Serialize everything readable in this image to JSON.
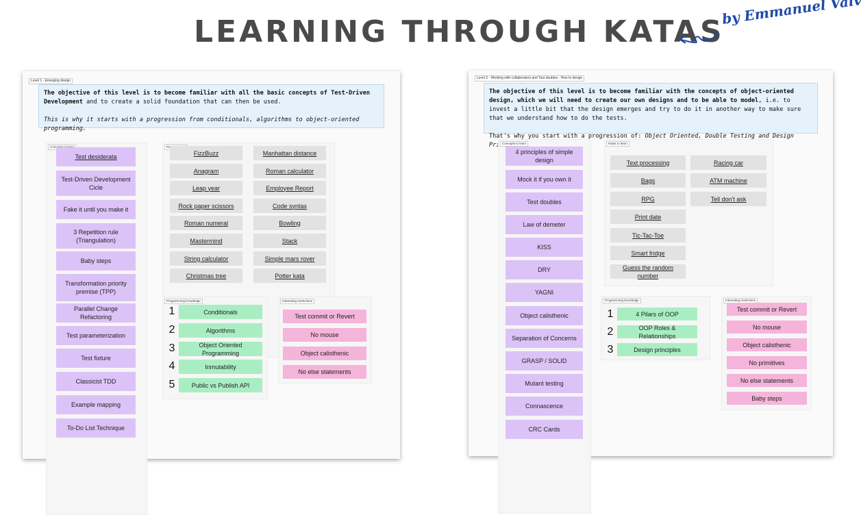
{
  "header": {
    "title": "LEARNING THROUGH KATAS",
    "author": "by Emmanuel Valverde"
  },
  "level1": {
    "tag": "Level 1 - Emerging design",
    "description": {
      "p1_bold": "The objective of this level is to become familiar with all the basic concepts of Test-Driven Development",
      "p1_rest": " and to create a solid foundation that can then be used.",
      "p2": "This is why it starts with a progression from conditionals, algorithms to object-oriented programming."
    },
    "concepts": {
      "tag": "Concepts to learn",
      "items": [
        "Test desiderata",
        "Test-Driven Development Cicle",
        "Fake it until you make it",
        "3 Repetition rule (Triangulation)",
        "Baby steps",
        "Transformation priority premise (TPP)",
        "Parallel Change Refactoring",
        "Test parameterization",
        "Test fixture",
        "Classicist TDD",
        "Example mapping",
        "To-Do List Technique"
      ]
    },
    "katas": {
      "tag": "Katas to solve",
      "col1": [
        "FizzBuzz",
        "Anagram",
        "Leap year",
        "Rock paper scissors",
        "Roman numeral",
        "Mastermind",
        "String calculator",
        "Christmas tree"
      ],
      "col2": [
        "Manhattan distance",
        "Roman calculator",
        "Employee Report",
        "Code syntax",
        "Bowling",
        "Stack",
        "Simple mars rover",
        "Potter kata"
      ]
    },
    "knowledge": {
      "tag": "Programming knowledge",
      "items": [
        {
          "num": "1",
          "label": "Conditionals"
        },
        {
          "num": "2",
          "label": "Algorithms"
        },
        {
          "num": "3",
          "label": "Object Oriented Programming"
        },
        {
          "num": "4",
          "label": "Inmutability"
        },
        {
          "num": "5",
          "label": "Public vs Publish API"
        }
      ]
    },
    "restrictions": {
      "tag": "Interesting restrictions",
      "items": [
        "Test commit or Revert",
        "No mouse",
        "Object calisthenic",
        "No else statements"
      ]
    }
  },
  "level2": {
    "tag": "Level 2 - Working with collaborators and Test doubles - How to design",
    "description": {
      "p1_bold": "The objective of this level is to become familiar with the concepts of object-oriented design, which we will need to create our own designs and to be able to model",
      "p1_rest": ", i.e. to invest a little bit that the design emerges and try to do it in another way to make sure that we understand how to do the tests.",
      "p2_lead": "That's why you start with a progression of: ",
      "p2_italic": "Object Oriented, Double Testing and Design Principles",
      "p2_end": "."
    },
    "concepts": {
      "tag": "Concepts to learn",
      "items": [
        "4 principles of simple design",
        "Mock it if you own it",
        "Test doubles",
        "Law of demeter",
        "KISS",
        "DRY",
        "YAGNI",
        "Object calisthenic",
        "Separation of Concerns",
        "GRASP / SOLID",
        "Mutant testing",
        "Connascence",
        "CRC Cards"
      ]
    },
    "katas": {
      "tag": "Katas to learn",
      "col1": [
        "Text processing",
        "Bags",
        "RPG",
        "Print  date",
        "Tic-Tac-Toe",
        "Smart fridge",
        "Guess the random number"
      ],
      "col2": [
        "Racing car",
        "ATM machine",
        "Tell don't ask"
      ]
    },
    "knowledge": {
      "tag": "Programming knowledge",
      "items": [
        {
          "num": "1",
          "label": "4 Pilars of OOP"
        },
        {
          "num": "2",
          "label": "OOP Roles & Relationships"
        },
        {
          "num": "3",
          "label": "Design principles"
        }
      ]
    },
    "restrictions": {
      "tag": "Interesting restrictions",
      "items": [
        "Test commit or Revert",
        "No mouse",
        "Object calisthenic",
        "No primitives",
        "No else statements",
        "Baby steps"
      ]
    }
  }
}
